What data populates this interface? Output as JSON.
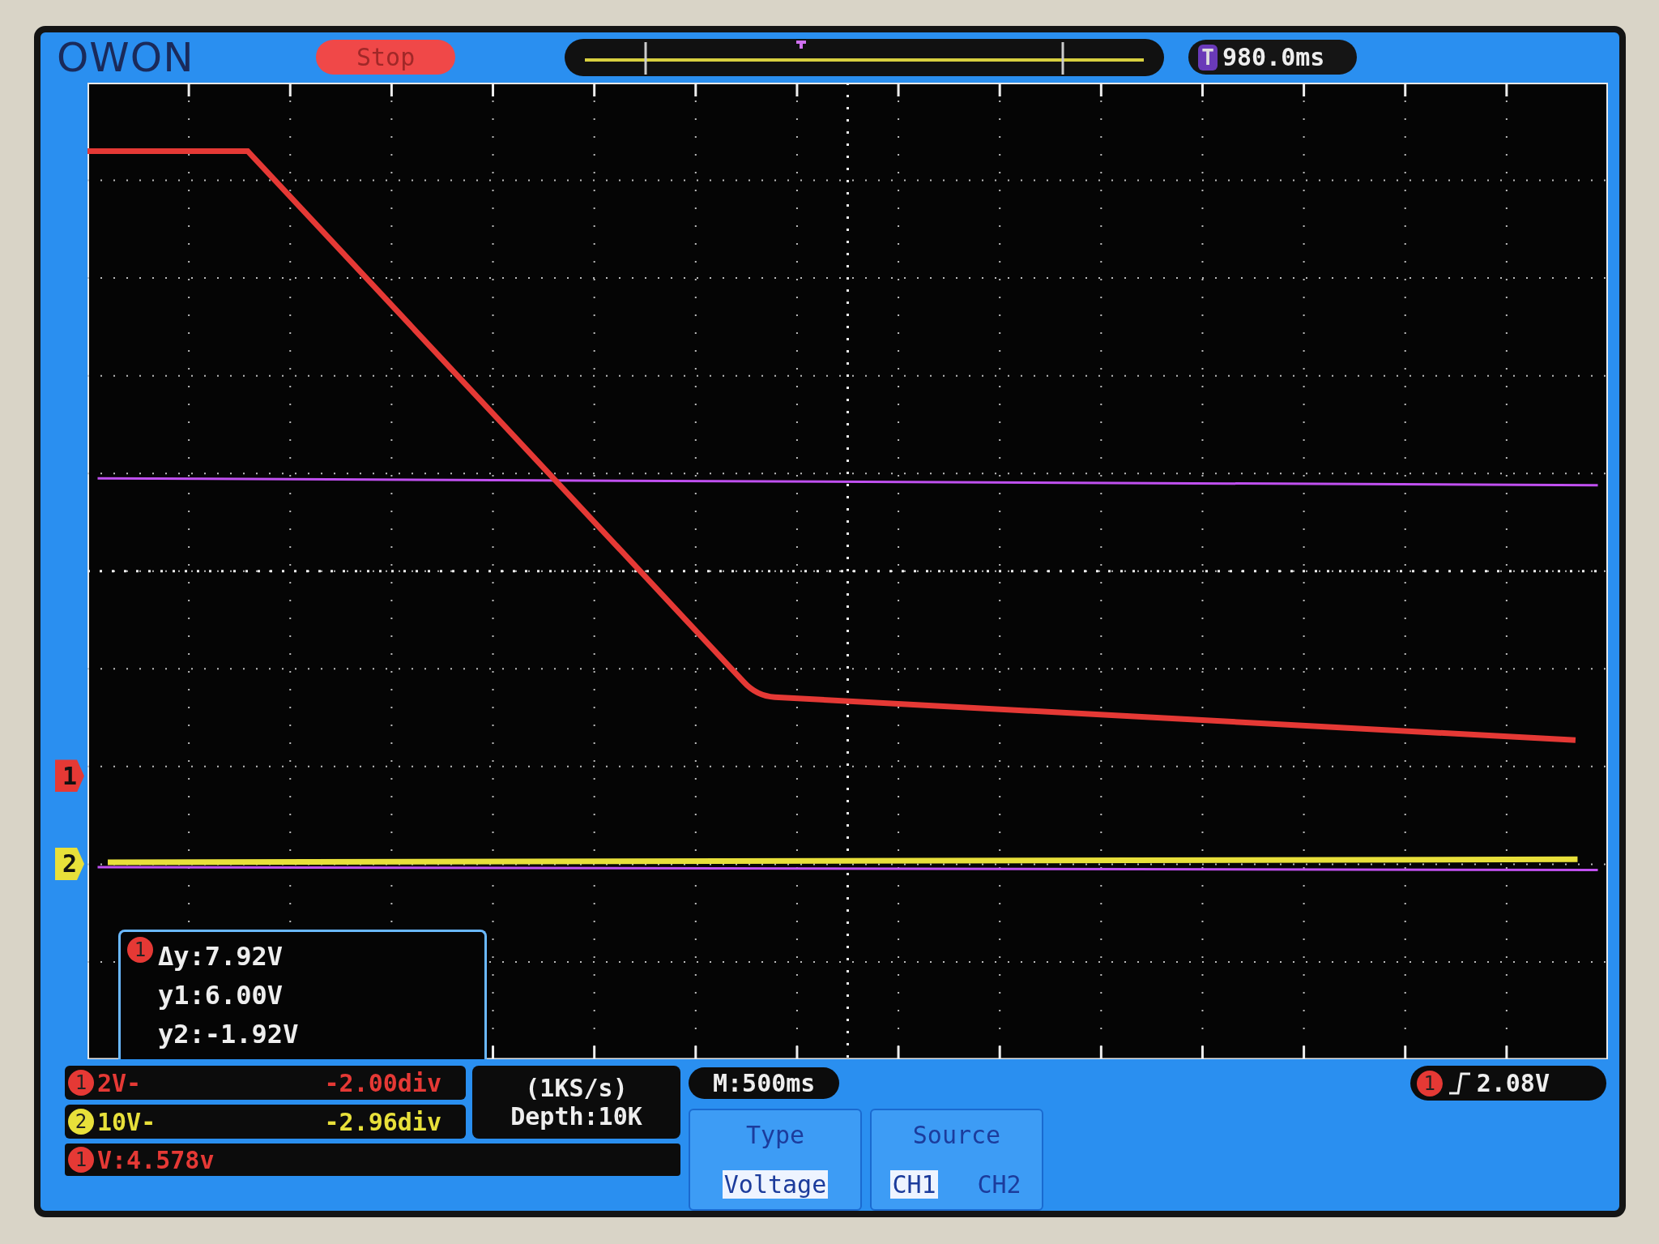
{
  "header": {
    "logo": "OWON",
    "run_state": "Stop",
    "trigger_badge": "T",
    "trigger_time": "980.0ms"
  },
  "channel_markers": [
    {
      "label": "1",
      "color": "#e53935"
    },
    {
      "label": "2",
      "color": "#e8e03a"
    }
  ],
  "cursor_readout": {
    "channel": "1",
    "lines": [
      "Δy:7.92V",
      "y1:6.00V",
      "y2:-1.92V"
    ]
  },
  "channels": [
    {
      "channel": "1",
      "scale": "2V-",
      "offset": "-2.00div",
      "color": "#e53935"
    },
    {
      "channel": "2",
      "scale": "10V-",
      "offset": "-2.96div",
      "color": "#e8e03a"
    }
  ],
  "sampling": {
    "rate": "(1KS/s)",
    "depth": "Depth:10K"
  },
  "measure": {
    "channel": "1",
    "reading": "V:4.578v"
  },
  "timebase": "M:500ms",
  "trigger": {
    "channel": "1",
    "value": "2.08V"
  },
  "menu": [
    {
      "title": "Type",
      "options": [
        {
          "label": "Voltage",
          "selected": true
        }
      ]
    },
    {
      "title": "Source",
      "options": [
        {
          "label": "CH1",
          "selected": true
        },
        {
          "label": "CH2",
          "selected": false
        }
      ]
    }
  ]
}
